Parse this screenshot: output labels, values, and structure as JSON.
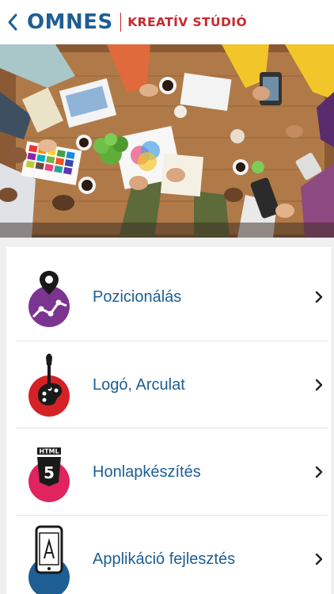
{
  "header": {
    "brand": "OMNES",
    "subtitle": "KREATÍV STÚDIÓ",
    "brand_color": "#1d5e94",
    "accent_color": "#c8282e"
  },
  "hero": {
    "icon": "team-meeting-photo"
  },
  "menu": {
    "items": [
      {
        "label": "Pozicionálás",
        "icon": "map-pin-chart-icon",
        "color": "#7b3590"
      },
      {
        "label": "Logó, Arculat",
        "icon": "paint-brush-palette-icon",
        "color": "#d42226"
      },
      {
        "label": "Honlapkészítés",
        "icon": "html5-icon",
        "color": "#e0245e"
      },
      {
        "label": "Applikáció fejlesztés",
        "icon": "smartphone-app-icon",
        "color": "#1d5e94"
      }
    ]
  }
}
